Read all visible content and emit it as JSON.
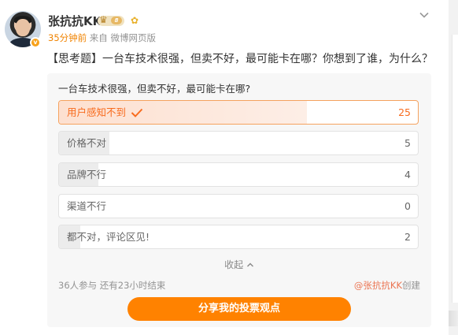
{
  "author": {
    "name": "张抗抗KK",
    "vip_level": "8"
  },
  "meta": {
    "time": "35分钟前",
    "source": "来自 微博网页版"
  },
  "post": {
    "text": "【思考题】一台车技术很强，但卖不好，最可能卡在哪？你想到了谁，为什么？"
  },
  "poll": {
    "question": "一台车技术很强，但卖不好，最可能卡在哪?",
    "options": [
      {
        "label": "用户感知不到",
        "count": "25",
        "share": 0.69,
        "selected": true
      },
      {
        "label": "价格不对",
        "count": "5",
        "share": 0.14,
        "selected": false
      },
      {
        "label": "品牌不行",
        "count": "4",
        "share": 0.11,
        "selected": false
      },
      {
        "label": "渠道不行",
        "count": "0",
        "share": 0.0,
        "selected": false
      },
      {
        "label": "都不对，评论区见!",
        "count": "2",
        "share": 0.06,
        "selected": false
      }
    ],
    "collapse_label": "收起",
    "participants": "36人参与 还有23小时结束",
    "creator_handle": "@张抗抗KK",
    "creator_suffix": "创建",
    "share_button": "分享我的投票观点"
  },
  "colors": {
    "accent": "#ff8200",
    "selected_text": "#f86b1d",
    "meta_gray": "#939393"
  },
  "icons": [
    "verified-badge-icon",
    "vip-crown-icon",
    "flower-icon",
    "chevron-down-icon",
    "check-icon",
    "chevron-up-icon"
  ]
}
